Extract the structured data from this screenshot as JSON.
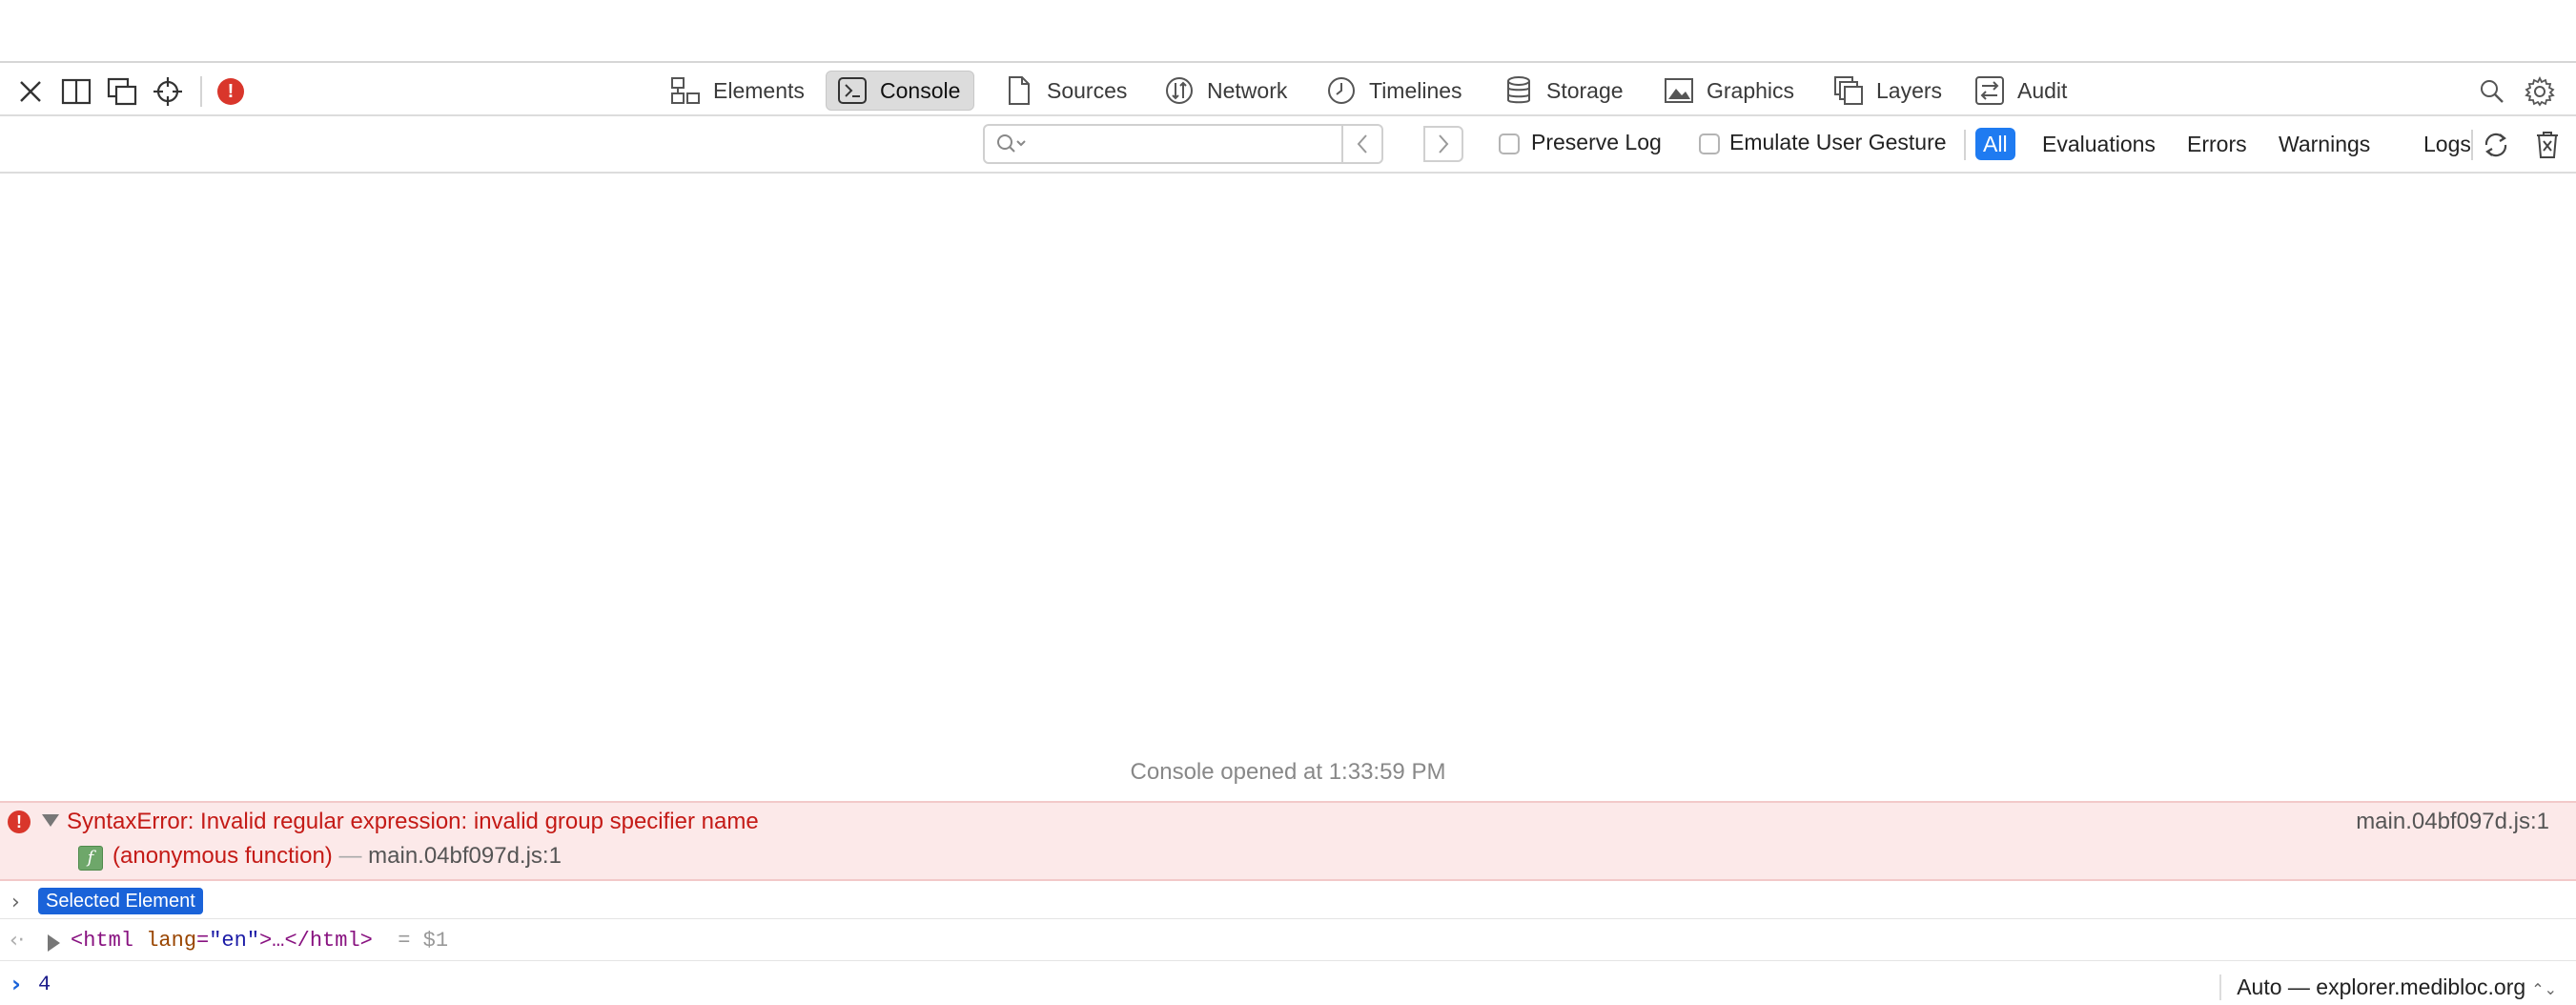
{
  "toolbar": {
    "tabs": [
      {
        "label": "Elements",
        "icon": "elements-icon"
      },
      {
        "label": "Console",
        "icon": "console-icon"
      },
      {
        "label": "Sources",
        "icon": "sources-icon"
      },
      {
        "label": "Network",
        "icon": "network-icon"
      },
      {
        "label": "Timelines",
        "icon": "timelines-icon"
      },
      {
        "label": "Storage",
        "icon": "storage-icon"
      },
      {
        "label": "Graphics",
        "icon": "graphics-icon"
      },
      {
        "label": "Layers",
        "icon": "layers-icon"
      },
      {
        "label": "Audit",
        "icon": "audit-icon"
      }
    ],
    "active_tab": "Console",
    "error_indicator": "!"
  },
  "filter": {
    "search_placeholder": "",
    "preserve_log_label": "Preserve Log",
    "emulate_gesture_label": "Emulate User Gesture",
    "levels": [
      "All",
      "Evaluations",
      "Errors",
      "Warnings",
      "Logs"
    ],
    "active_level": "All"
  },
  "console": {
    "opened_message": "Console opened at 1:33:59 PM",
    "error": {
      "icon": "!",
      "message": "SyntaxError: Invalid regular expression: invalid group specifier name",
      "source": "main.04bf097d.js:1",
      "frame_badge": "f",
      "frame_function": "(anonymous function)",
      "frame_dash": "—",
      "frame_location": "main.04bf097d.js:1"
    },
    "selected_element_label": "Selected Element",
    "html_entry": {
      "open_tag_start": "<html",
      "attr_name": "lang",
      "attr_value": "\"en\"",
      "open_tag_end": ">…</html>",
      "binding": "= $1"
    },
    "prompt_value": "4",
    "context_label": "Auto — explorer.medibloc.org",
    "context_arrows": "⌃⌄"
  },
  "colors": {
    "accent": "#1f7bf1",
    "error_text": "#c41a16",
    "error_bg": "#fce9e9",
    "badge": "#1a63d9"
  }
}
